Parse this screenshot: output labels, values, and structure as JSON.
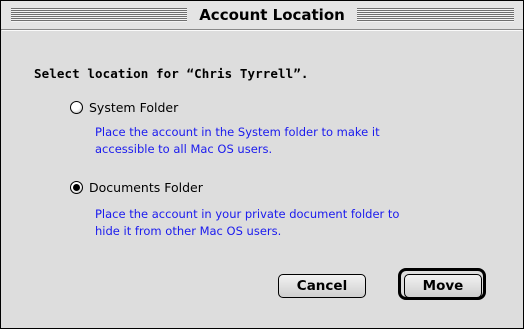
{
  "dialog": {
    "title": "Account Location",
    "prompt": "Select location for “Chris Tyrrell”.",
    "options": [
      {
        "label": "System Folder",
        "selected": false,
        "description_line1": "Place the account in the System folder to make it",
        "description_line2": "accessible to all Mac OS users."
      },
      {
        "label": "Documents Folder",
        "selected": true,
        "description_line1": "Place the account in your private document folder to",
        "description_line2": "hide it from other Mac OS users."
      }
    ],
    "buttons": {
      "cancel": "Cancel",
      "move": "Move"
    },
    "colors": {
      "background": "#dddddd",
      "description_text": "#1a1aee"
    }
  }
}
